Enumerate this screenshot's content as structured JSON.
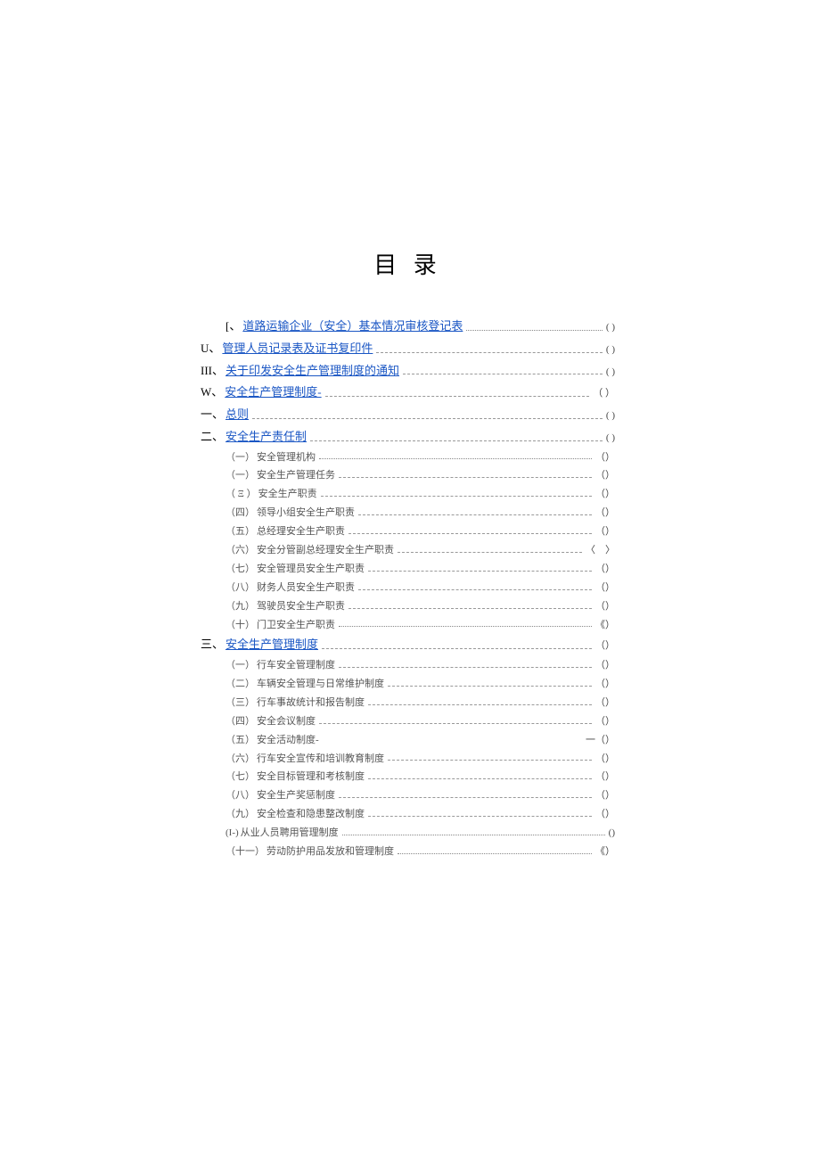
{
  "title": "目 录",
  "entries": [
    {
      "prefix": "[、",
      "label": "道路运输企业（安全）基本情况审核登记表",
      "page": "( )",
      "link": true,
      "indent": 1,
      "leader": "dotted"
    },
    {
      "prefix": "U、",
      "label": "管理人员记录表及证书复印件",
      "page": "( )",
      "link": true,
      "indent": 0,
      "leader": "dash"
    },
    {
      "prefix": "III、",
      "label": "关于印发安全生产管理制度的通知",
      "page": "( )",
      "link": true,
      "indent": 0,
      "leader": "dash"
    },
    {
      "prefix": "W、",
      "label": "安全生产管理制度-",
      "page": "（ ）",
      "link": true,
      "indent": 0,
      "leader": "dash"
    },
    {
      "prefix": "一、",
      "label": "总则",
      "page": "( )",
      "link": true,
      "indent": 0,
      "leader": "dash"
    },
    {
      "prefix": "二、",
      "label": "安全生产责任制",
      "page": "( )",
      "link": true,
      "indent": 0,
      "leader": "dash"
    },
    {
      "prefix": "（一）",
      "label": "安全管理机构",
      "page": "（）",
      "link": false,
      "indent": 2,
      "leader": "dotted"
    },
    {
      "prefix": "（一）",
      "label": "安全生产管理任务",
      "page": "（）",
      "link": false,
      "indent": 2,
      "leader": "dash"
    },
    {
      "prefix": "（ Ξ ）",
      "label": "安全生产职责",
      "page": "（）",
      "link": false,
      "indent": 2,
      "leader": "dash"
    },
    {
      "prefix": "（四）",
      "label": "领导小组安全生产职责",
      "page": "（）",
      "link": false,
      "indent": 2,
      "leader": "dash"
    },
    {
      "prefix": "（五）",
      "label": "总经理安全生产职责",
      "page": "（）",
      "link": false,
      "indent": 2,
      "leader": "dash"
    },
    {
      "prefix": "（六）",
      "label": "安全分管副总经理安全生产职责",
      "page": "〈　〉",
      "link": false,
      "indent": 2,
      "leader": "dash"
    },
    {
      "prefix": "（七）",
      "label": "安全管理员安全生产职责",
      "page": "（）",
      "link": false,
      "indent": 2,
      "leader": "dash"
    },
    {
      "prefix": "（八）",
      "label": "财务人员安全生产职责",
      "page": "（）",
      "link": false,
      "indent": 2,
      "leader": "dash"
    },
    {
      "prefix": "（九）",
      "label": "驾驶员安全生产职责",
      "page": "（）",
      "link": false,
      "indent": 2,
      "leader": "dash"
    },
    {
      "prefix": "（十）",
      "label": "门卫安全生产职责",
      "page": "《）",
      "link": false,
      "indent": 2,
      "leader": "dotted"
    },
    {
      "prefix": "三、",
      "label": "安全生产管理制度",
      "page": "（）",
      "link": true,
      "indent": 0,
      "leader": "dash"
    },
    {
      "prefix": "（一）",
      "label": "行车安全管理制度",
      "page": "（）",
      "link": false,
      "indent": 2,
      "leader": "dash"
    },
    {
      "prefix": "（二）",
      "label": "车辆安全管理与日常维护制度",
      "page": "（）",
      "link": false,
      "indent": 2,
      "leader": "dash"
    },
    {
      "prefix": "（三）",
      "label": "行车事故统计和报告制度",
      "page": "（）",
      "link": false,
      "indent": 2,
      "leader": "dash"
    },
    {
      "prefix": "（四）",
      "label": "安全会议制度",
      "page": "（）",
      "link": false,
      "indent": 2,
      "leader": "dash"
    },
    {
      "prefix": "（五）",
      "label": "安全活动制度-",
      "page": "一（）",
      "link": false,
      "indent": 2,
      "leader": "blank"
    },
    {
      "prefix": "（六）",
      "label": "行车安全宣传和培训教育制度",
      "page": "（）",
      "link": false,
      "indent": 2,
      "leader": "dash"
    },
    {
      "prefix": "（七）",
      "label": "安全目标管理和考核制度",
      "page": "（）",
      "link": false,
      "indent": 2,
      "leader": "dash"
    },
    {
      "prefix": "（八）",
      "label": "安全生产奖惩制度",
      "page": "（）",
      "link": false,
      "indent": 2,
      "leader": "dash"
    },
    {
      "prefix": "（九）",
      "label": "安全检查和隐患整改制度",
      "page": "（）",
      "link": false,
      "indent": 2,
      "leader": "dash"
    },
    {
      "prefix": "(I-)",
      "label": "从业人员聘用管理制度",
      "page": "()",
      "link": false,
      "indent": 2,
      "leader": "dotted"
    },
    {
      "prefix": "（十一）",
      "label": "劳动防护用品发放和管理制度",
      "page": "《）",
      "link": false,
      "indent": 2,
      "leader": "dotted"
    }
  ]
}
